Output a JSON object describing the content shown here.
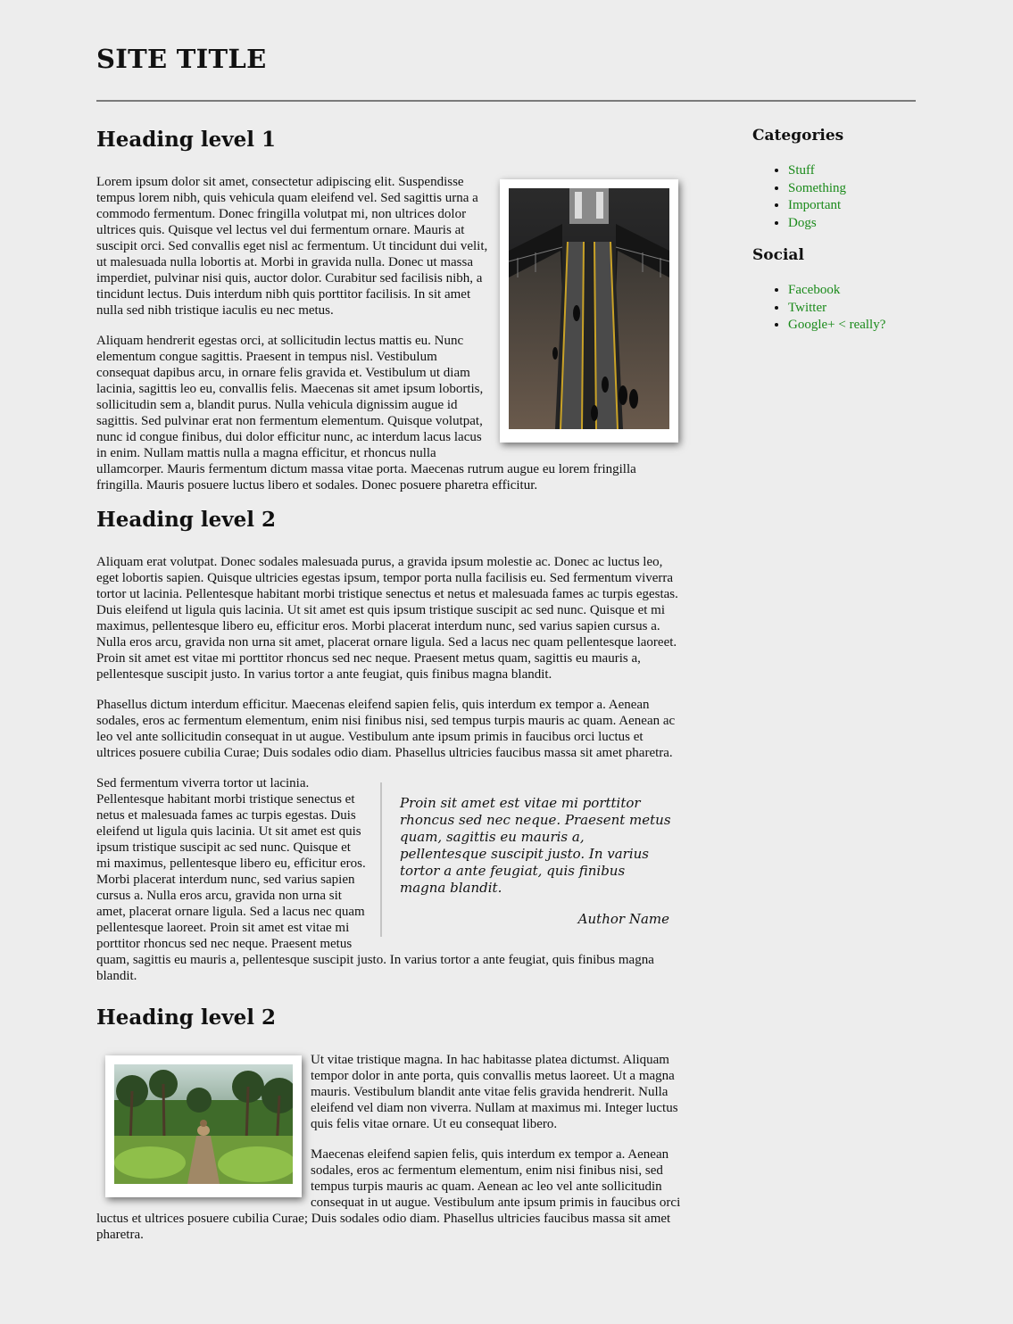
{
  "site": {
    "title": "SITE TITLE"
  },
  "main": {
    "section1": {
      "heading": "Heading level 1",
      "p1": "Lorem ipsum dolor sit amet, consectetur adipiscing elit. Suspendisse tempus lorem nibh, quis vehicula quam eleifend vel. Sed sagittis urna a commodo fermentum. Donec fringilla volutpat mi, non ultrices dolor ultrices quis. Quisque vel lectus vel dui fermentum ornare. Mauris at suscipit orci. Sed convallis eget nisl ac fermentum. Ut tincidunt dui velit, ut malesuada nulla lobortis at. Morbi in gravida nulla. Donec ut massa imperdiet, pulvinar nisi quis, auctor dolor. Curabitur sed facilisis nibh, a tincidunt lectus. Duis interdum nibh quis porttitor facilisis. In sit amet nulla sed nibh tristique iaculis eu nec metus.",
      "p2": "Aliquam hendrerit egestas orci, at sollicitudin lectus mattis eu. Nunc elementum congue sagittis. Praesent in tempus nisl. Vestibulum consequat dapibus arcu, in ornare felis gravida et. Vestibulum ut diam lacinia, sagittis leo eu, convallis felis. Maecenas sit amet ipsum lobortis, sollicitudin sem a, blandit purus. Nulla vehicula dignissim augue id sagittis. Sed pulvinar erat non fermentum elementum. Quisque volutpat, nunc id congue finibus, dui dolor efficitur nunc, ac interdum lacus lacus in enim. Nullam mattis nulla a magna efficitur, et rhoncus nulla ullamcorper. Mauris fermentum dictum massa vitae porta. Maecenas rutrum augue eu lorem fringilla fringilla. Mauris posuere luctus libero et sodales. Donec posuere pharetra efficitur."
    },
    "section2": {
      "heading": "Heading level 2",
      "p1": "Aliquam erat volutpat. Donec sodales malesuada purus, a gravida ipsum molestie ac. Donec ac luctus leo, eget lobortis sapien. Quisque ultricies egestas ipsum, tempor porta nulla facilisis eu. Sed fermentum viverra tortor ut lacinia. Pellentesque habitant morbi tristique senectus et netus et malesuada fames ac turpis egestas. Duis eleifend ut ligula quis lacinia. Ut sit amet est quis ipsum tristique suscipit ac sed nunc. Quisque et mi maximus, pellentesque libero eu, efficitur eros. Morbi placerat interdum nunc, sed varius sapien cursus a. Nulla eros arcu, gravida non urna sit amet, placerat ornare ligula. Sed a lacus nec quam pellentesque laoreet. Proin sit amet est vitae mi porttitor rhoncus sed nec neque. Praesent metus quam, sagittis eu mauris a, pellentesque suscipit justo. In varius tortor a ante feugiat, quis finibus magna blandit.",
      "p2": "Phasellus dictum interdum efficitur. Maecenas eleifend sapien felis, quis interdum ex tempor a. Aenean sodales, eros ac fermentum elementum, enim nisi finibus nisi, sed tempus turpis mauris ac quam. Aenean ac leo vel ante sollicitudin consequat in ut augue. Vestibulum ante ipsum primis in faucibus orci luctus et ultrices posuere cubilia Curae; Duis sodales odio diam. Phasellus ultricies faucibus massa sit amet pharetra.",
      "p3": "Sed fermentum viverra tortor ut lacinia. Pellentesque habitant morbi tristique senectus et netus et malesuada fames ac turpis egestas. Duis eleifend ut ligula quis lacinia. Ut sit amet est quis ipsum tristique suscipit ac sed nunc. Quisque et mi maximus, pellentesque libero eu, efficitur eros. Morbi placerat interdum nunc, sed varius sapien cursus a. Nulla eros arcu, gravida non urna sit amet, placerat ornare ligula. Sed a lacus nec quam pellentesque laoreet. Proin sit amet est vitae mi porttitor rhoncus sed nec neque. Praesent metus quam, sagittis eu mauris a, pellentesque suscipit justo. In varius tortor a ante feugiat, quis finibus magna blandit.",
      "quote": {
        "text": "Proin sit amet est vitae mi porttitor rhoncus sed nec neque. Praesent metus quam, sagittis eu mauris a, pellentesque suscipit justo. In varius tortor a ante feugiat, quis finibus magna blandit.",
        "author": "Author Name"
      }
    },
    "section3": {
      "heading": "Heading level 2",
      "p1": "Ut vitae tristique magna. In hac habitasse platea dictumst. Aliquam tempor dolor in ante porta, quis convallis metus laoreet. Ut a magna mauris. Vestibulum blandit ante vitae felis gravida hendrerit. Nulla eleifend vel diam non viverra. Nullam at maximus mi. Integer luctus quis felis vitae ornare. Ut eu consequat libero.",
      "p2": "Maecenas eleifend sapien felis, quis interdum ex tempor a. Aenean sodales, eros ac fermentum elementum, enim nisi finibus nisi, sed tempus turpis mauris ac quam. Aenean ac leo vel ante sollicitudin consequat in ut augue. Vestibulum ante ipsum primis in faucibus orci luctus et ultrices posuere cubilia Curae; Duis sodales odio diam. Phasellus ultricies faucibus massa sit amet pharetra."
    }
  },
  "sidebar": {
    "categories": {
      "heading": "Categories",
      "items": [
        "Stuff",
        "Something",
        "Important",
        "Dogs"
      ]
    },
    "social": {
      "heading": "Social",
      "items": [
        "Facebook",
        "Twitter",
        "Google+ < really?"
      ]
    }
  },
  "colors": {
    "link": "#1a8a1a",
    "background": "#ededed"
  }
}
